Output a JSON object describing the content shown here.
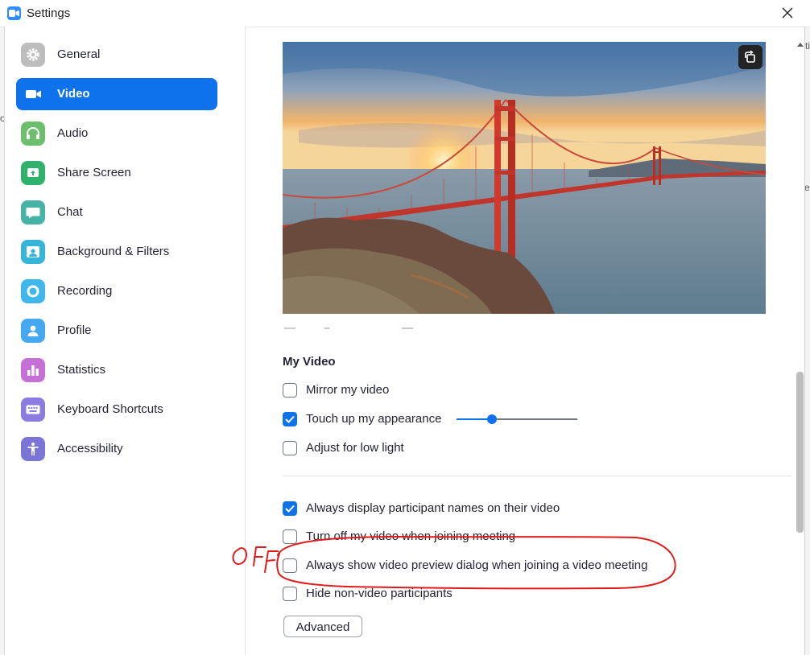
{
  "window": {
    "title": "Settings"
  },
  "background_fragments": [
    "ti",
    "o",
    "es"
  ],
  "sidebar": {
    "items": [
      {
        "label": "General",
        "icon": "gear-icon",
        "color": "#bdbdbd",
        "active": false
      },
      {
        "label": "Video",
        "icon": "video-camera-icon",
        "color": "#0E72ED",
        "active": true
      },
      {
        "label": "Audio",
        "icon": "headphones-icon",
        "color": "#6DBE6D",
        "active": false
      },
      {
        "label": "Share Screen",
        "icon": "share-screen-icon",
        "color": "#31B26C",
        "active": false
      },
      {
        "label": "Chat",
        "icon": "chat-bubble-icon",
        "color": "#46B3A6",
        "active": false
      },
      {
        "label": "Background & Filters",
        "icon": "background-person-icon",
        "color": "#36B5D9",
        "active": false
      },
      {
        "label": "Recording",
        "icon": "record-icon",
        "color": "#40B7EC",
        "active": false
      },
      {
        "label": "Profile",
        "icon": "person-icon",
        "color": "#45A8F0",
        "active": false
      },
      {
        "label": "Statistics",
        "icon": "bar-chart-icon",
        "color": "#C66FD6",
        "active": false
      },
      {
        "label": "Keyboard Shortcuts",
        "icon": "keyboard-icon",
        "color": "#8C7CE0",
        "active": false
      },
      {
        "label": "Accessibility",
        "icon": "accessibility-icon",
        "color": "#7C75D8",
        "active": false
      }
    ]
  },
  "main": {
    "preview_alt": "Golden Gate Bridge at sunset",
    "my_video": {
      "heading": "My Video",
      "mirror": {
        "label": "Mirror my video",
        "checked": false
      },
      "touch_up": {
        "label": "Touch up my appearance",
        "checked": true,
        "slider_value": 0.29
      },
      "low_light": {
        "label": "Adjust for low light",
        "checked": false
      }
    },
    "options": {
      "display_names": {
        "label": "Always display participant names on their video",
        "checked": true
      },
      "turn_off": {
        "label": "Turn off my video when joining meeting",
        "checked": false
      },
      "preview_dialog": {
        "label": "Always show video preview dialog when joining a video meeting",
        "checked": false
      },
      "hide_nonvideo": {
        "label": "Hide non-video participants",
        "checked": false
      }
    },
    "advanced_label": "Advanced"
  },
  "annotation": {
    "text": "OFF",
    "color": "#e01b1b"
  },
  "colors": {
    "accent": "#0E72ED",
    "text": "#232333"
  }
}
